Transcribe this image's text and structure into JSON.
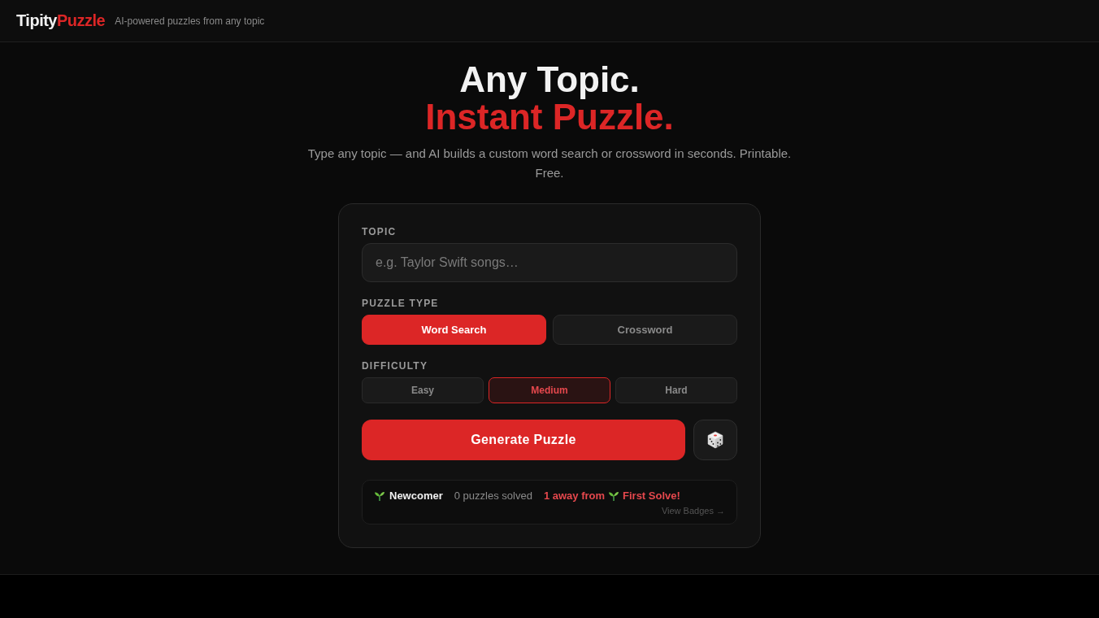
{
  "header": {
    "logo": [
      {
        "text": "Tipity",
        "kind": "plain"
      },
      {
        "text": "Puzzle",
        "kind": "accent"
      }
    ],
    "tagline": "AI-powered puzzles from any topic"
  },
  "hero": {
    "title_lines": [
      {
        "text": "Any Topic.",
        "kind": "plain"
      },
      {
        "text": "Instant Puzzle.",
        "kind": "accent"
      }
    ],
    "subtitle": "Type any topic — and AI builds a custom word search or crossword in seconds. Printable. Free."
  },
  "form": {
    "topic": {
      "label": "TOPIC",
      "placeholder": "e.g. Taylor Swift songs…"
    },
    "puzzle_type": {
      "label": "PUZZLE TYPE",
      "options": [
        {
          "label": "Word Search",
          "selected": true
        },
        {
          "label": "Crossword",
          "selected": false
        }
      ]
    },
    "difficulty": {
      "label": "DIFFICULTY",
      "options": [
        {
          "label": "Easy",
          "selected": false
        },
        {
          "label": "Medium",
          "selected": true
        },
        {
          "label": "Hard",
          "selected": false
        }
      ]
    },
    "generate_button": "Generate Puzzle"
  },
  "progress": {
    "rank": "Newcomer",
    "solved": "0 puzzles solved",
    "next_prefix": "1 away from",
    "next_badge": "First Solve!",
    "link": "View Badges →"
  }
}
